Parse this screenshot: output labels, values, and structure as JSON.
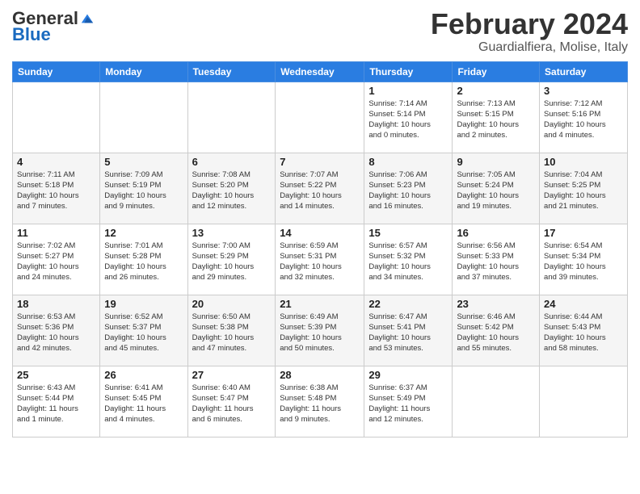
{
  "logo": {
    "general": "General",
    "blue": "Blue"
  },
  "title": "February 2024",
  "subtitle": "Guardialfiera, Molise, Italy",
  "header": {
    "days": [
      "Sunday",
      "Monday",
      "Tuesday",
      "Wednesday",
      "Thursday",
      "Friday",
      "Saturday"
    ]
  },
  "weeks": [
    [
      {
        "day": "",
        "info": ""
      },
      {
        "day": "",
        "info": ""
      },
      {
        "day": "",
        "info": ""
      },
      {
        "day": "",
        "info": ""
      },
      {
        "day": "1",
        "info": "Sunrise: 7:14 AM\nSunset: 5:14 PM\nDaylight: 10 hours\nand 0 minutes."
      },
      {
        "day": "2",
        "info": "Sunrise: 7:13 AM\nSunset: 5:15 PM\nDaylight: 10 hours\nand 2 minutes."
      },
      {
        "day": "3",
        "info": "Sunrise: 7:12 AM\nSunset: 5:16 PM\nDaylight: 10 hours\nand 4 minutes."
      }
    ],
    [
      {
        "day": "4",
        "info": "Sunrise: 7:11 AM\nSunset: 5:18 PM\nDaylight: 10 hours\nand 7 minutes."
      },
      {
        "day": "5",
        "info": "Sunrise: 7:09 AM\nSunset: 5:19 PM\nDaylight: 10 hours\nand 9 minutes."
      },
      {
        "day": "6",
        "info": "Sunrise: 7:08 AM\nSunset: 5:20 PM\nDaylight: 10 hours\nand 12 minutes."
      },
      {
        "day": "7",
        "info": "Sunrise: 7:07 AM\nSunset: 5:22 PM\nDaylight: 10 hours\nand 14 minutes."
      },
      {
        "day": "8",
        "info": "Sunrise: 7:06 AM\nSunset: 5:23 PM\nDaylight: 10 hours\nand 16 minutes."
      },
      {
        "day": "9",
        "info": "Sunrise: 7:05 AM\nSunset: 5:24 PM\nDaylight: 10 hours\nand 19 minutes."
      },
      {
        "day": "10",
        "info": "Sunrise: 7:04 AM\nSunset: 5:25 PM\nDaylight: 10 hours\nand 21 minutes."
      }
    ],
    [
      {
        "day": "11",
        "info": "Sunrise: 7:02 AM\nSunset: 5:27 PM\nDaylight: 10 hours\nand 24 minutes."
      },
      {
        "day": "12",
        "info": "Sunrise: 7:01 AM\nSunset: 5:28 PM\nDaylight: 10 hours\nand 26 minutes."
      },
      {
        "day": "13",
        "info": "Sunrise: 7:00 AM\nSunset: 5:29 PM\nDaylight: 10 hours\nand 29 minutes."
      },
      {
        "day": "14",
        "info": "Sunrise: 6:59 AM\nSunset: 5:31 PM\nDaylight: 10 hours\nand 32 minutes."
      },
      {
        "day": "15",
        "info": "Sunrise: 6:57 AM\nSunset: 5:32 PM\nDaylight: 10 hours\nand 34 minutes."
      },
      {
        "day": "16",
        "info": "Sunrise: 6:56 AM\nSunset: 5:33 PM\nDaylight: 10 hours\nand 37 minutes."
      },
      {
        "day": "17",
        "info": "Sunrise: 6:54 AM\nSunset: 5:34 PM\nDaylight: 10 hours\nand 39 minutes."
      }
    ],
    [
      {
        "day": "18",
        "info": "Sunrise: 6:53 AM\nSunset: 5:36 PM\nDaylight: 10 hours\nand 42 minutes."
      },
      {
        "day": "19",
        "info": "Sunrise: 6:52 AM\nSunset: 5:37 PM\nDaylight: 10 hours\nand 45 minutes."
      },
      {
        "day": "20",
        "info": "Sunrise: 6:50 AM\nSunset: 5:38 PM\nDaylight: 10 hours\nand 47 minutes."
      },
      {
        "day": "21",
        "info": "Sunrise: 6:49 AM\nSunset: 5:39 PM\nDaylight: 10 hours\nand 50 minutes."
      },
      {
        "day": "22",
        "info": "Sunrise: 6:47 AM\nSunset: 5:41 PM\nDaylight: 10 hours\nand 53 minutes."
      },
      {
        "day": "23",
        "info": "Sunrise: 6:46 AM\nSunset: 5:42 PM\nDaylight: 10 hours\nand 55 minutes."
      },
      {
        "day": "24",
        "info": "Sunrise: 6:44 AM\nSunset: 5:43 PM\nDaylight: 10 hours\nand 58 minutes."
      }
    ],
    [
      {
        "day": "25",
        "info": "Sunrise: 6:43 AM\nSunset: 5:44 PM\nDaylight: 11 hours\nand 1 minute."
      },
      {
        "day": "26",
        "info": "Sunrise: 6:41 AM\nSunset: 5:45 PM\nDaylight: 11 hours\nand 4 minutes."
      },
      {
        "day": "27",
        "info": "Sunrise: 6:40 AM\nSunset: 5:47 PM\nDaylight: 11 hours\nand 6 minutes."
      },
      {
        "day": "28",
        "info": "Sunrise: 6:38 AM\nSunset: 5:48 PM\nDaylight: 11 hours\nand 9 minutes."
      },
      {
        "day": "29",
        "info": "Sunrise: 6:37 AM\nSunset: 5:49 PM\nDaylight: 11 hours\nand 12 minutes."
      },
      {
        "day": "",
        "info": ""
      },
      {
        "day": "",
        "info": ""
      }
    ]
  ]
}
